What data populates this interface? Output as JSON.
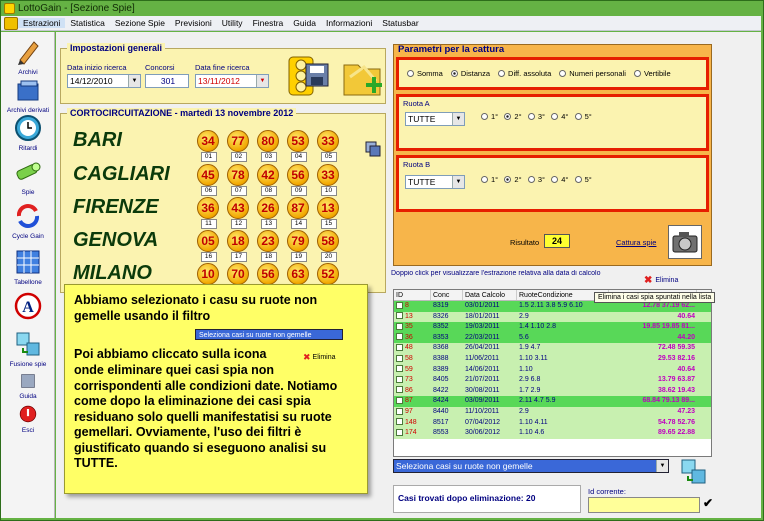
{
  "window": {
    "title": "LottoGain - [Sezione Spie]"
  },
  "menu": [
    "Estrazioni",
    "Statistica",
    "Sezione Spie",
    "Previsioni",
    "Utility",
    "Finestra",
    "Guida",
    "Informazioni",
    "Statusbar"
  ],
  "toolbar": {
    "archivi": "Archivi",
    "archivi_derivati": "Archivi derivati",
    "ritardi": "Ritardi",
    "spie": "Spie",
    "cycle_gain": "Cycle Gain",
    "tabellone": "Tabellone",
    "fusione_spie": "Fusione spie",
    "guida": "Guida",
    "esci": "Esci"
  },
  "impostazioni": {
    "title": "Impostazioni generali",
    "data_inizio_label": "Data inizio ricerca",
    "data_inizio": "14/12/2010",
    "concorsi_label": "Concorsi",
    "concorsi": "301",
    "data_fine_label": "Data fine ricerca",
    "data_fine": "13/11/2012"
  },
  "cortocircuitazione": {
    "title": "CORTOCIRCUITAZIONE - martedì 13 novembre 2012",
    "rows": [
      {
        "city": "BARI",
        "balls": [
          {
            "v": "34",
            "n": "01"
          },
          {
            "v": "77",
            "n": "02"
          },
          {
            "v": "80",
            "n": "03"
          },
          {
            "v": "53",
            "n": "04"
          },
          {
            "v": "33",
            "n": "05"
          }
        ]
      },
      {
        "city": "CAGLIARI",
        "balls": [
          {
            "v": "45",
            "n": "06"
          },
          {
            "v": "78",
            "n": "07"
          },
          {
            "v": "42",
            "n": "08"
          },
          {
            "v": "56",
            "n": "09"
          },
          {
            "v": "33",
            "n": "10"
          }
        ]
      },
      {
        "city": "FIRENZE",
        "balls": [
          {
            "v": "36",
            "n": "11"
          },
          {
            "v": "43",
            "n": "12"
          },
          {
            "v": "26",
            "n": "13"
          },
          {
            "v": "87",
            "n": "14"
          },
          {
            "v": "13",
            "n": "15"
          }
        ]
      },
      {
        "city": "GENOVA",
        "balls": [
          {
            "v": "05",
            "n": "16"
          },
          {
            "v": "18",
            "n": "17"
          },
          {
            "v": "23",
            "n": "18"
          },
          {
            "v": "79",
            "n": "19"
          },
          {
            "v": "58",
            "n": "20"
          }
        ]
      },
      {
        "city": "MILANO",
        "balls": [
          {
            "v": "10",
            "n": ""
          },
          {
            "v": "70",
            "n": ""
          },
          {
            "v": "56",
            "n": ""
          },
          {
            "v": "63",
            "n": ""
          },
          {
            "v": "52",
            "n": ""
          }
        ]
      }
    ]
  },
  "parametri": {
    "title": "Parametri per la cattura",
    "mode_options": [
      "Somma",
      "Distanza",
      "Diff. assoluta",
      "Numeri personali",
      "Vertibile"
    ],
    "mode_selected": 1,
    "ruota_a_label": "Ruota A",
    "ruota_a_value": "TUTTE",
    "ruota_b_label": "Ruota B",
    "ruota_b_value": "TUTTE",
    "position_options": [
      "1°",
      "2°",
      "3°",
      "4°",
      "5°"
    ],
    "position_selected": 1,
    "risultato_label": "Risultato",
    "risultato": "24",
    "cattura_spie": "Cattura spie"
  },
  "list": {
    "hint": "Doppio click per visualizzare l'estrazione relativa alla data di calcolo",
    "elimina_label": "Elimina",
    "tooltip": "Elimina i casi spia spuntati nella lista",
    "headers": [
      "ID",
      "Conc",
      "Data Calcolo",
      "RuoteCondizione",
      ""
    ],
    "rows": [
      {
        "id": "8",
        "conc": "8319",
        "data": "03/01/2011",
        "cond": "1.5 2.11 3.8 5.9 6.10",
        "nums": "12.78 37.19 62...",
        "green": true
      },
      {
        "id": "13",
        "conc": "8326",
        "data": "18/01/2011",
        "cond": "2.9",
        "nums": "40.64",
        "green": false
      },
      {
        "id": "35",
        "conc": "8352",
        "data": "19/03/2011",
        "cond": "1.4 1.10 2.8",
        "nums": "19.85 19.85 81...",
        "green": true
      },
      {
        "id": "36",
        "conc": "8353",
        "data": "22/03/2011",
        "cond": "5.6",
        "nums": "44.20",
        "green": true
      },
      {
        "id": "48",
        "conc": "8368",
        "data": "26/04/2011",
        "cond": "1.9 4.7",
        "nums": "72.48 59.35",
        "green": false
      },
      {
        "id": "58",
        "conc": "8388",
        "data": "11/06/2011",
        "cond": "1.10 3.11",
        "nums": "29.53 82.16",
        "green": false
      },
      {
        "id": "59",
        "conc": "8389",
        "data": "14/06/2011",
        "cond": "1.10",
        "nums": "40.64",
        "green": false
      },
      {
        "id": "73",
        "conc": "8405",
        "data": "21/07/2011",
        "cond": "2.9 6.8",
        "nums": "13.79 63.87",
        "green": false
      },
      {
        "id": "86",
        "conc": "8422",
        "data": "30/08/2011",
        "cond": "1.7 2.9",
        "nums": "38.62 19.43",
        "green": false
      },
      {
        "id": "87",
        "conc": "8424",
        "data": "03/09/2011",
        "cond": "2.11 4.7 5.9",
        "nums": "68.84 79.13 89...",
        "green": true
      },
      {
        "id": "97",
        "conc": "8440",
        "data": "11/10/2011",
        "cond": "2.9",
        "nums": "47.23",
        "green": false
      },
      {
        "id": "148",
        "conc": "8517",
        "data": "07/04/2012",
        "cond": "1.10 4.11",
        "nums": "54.78 52.76",
        "green": false
      },
      {
        "id": "174",
        "conc": "8553",
        "data": "30/06/2012",
        "cond": "1.10 4.6",
        "nums": "89.65 22.88",
        "green": false
      }
    ],
    "filter_value": "Seleziona casi su ruote non gemelle",
    "casi_trovati": "Casi trovati dopo eliminazione: 20",
    "id_corrente_label": "Id corrente:"
  },
  "callout": {
    "p1": "Abbiamo selezionato i casu su ruote non gemelle usando il filtro",
    "inline_combo": "Seleziona casi su ruote non gemelle",
    "p2_pre": "Poi abbiamo cliccato sulla icona",
    "inline_elimina": "Elimina",
    "p2_post": "onde eliminare quei casi spia non corrispondenti alle condizioni date. Notiamo come dopo la eliminazione dei casi spia residuano solo quelli manifestatisi su ruote gemellari. Ovviamente, l'uso dei filtri è giustificato quando si eseguono analisi su TUTTE."
  }
}
